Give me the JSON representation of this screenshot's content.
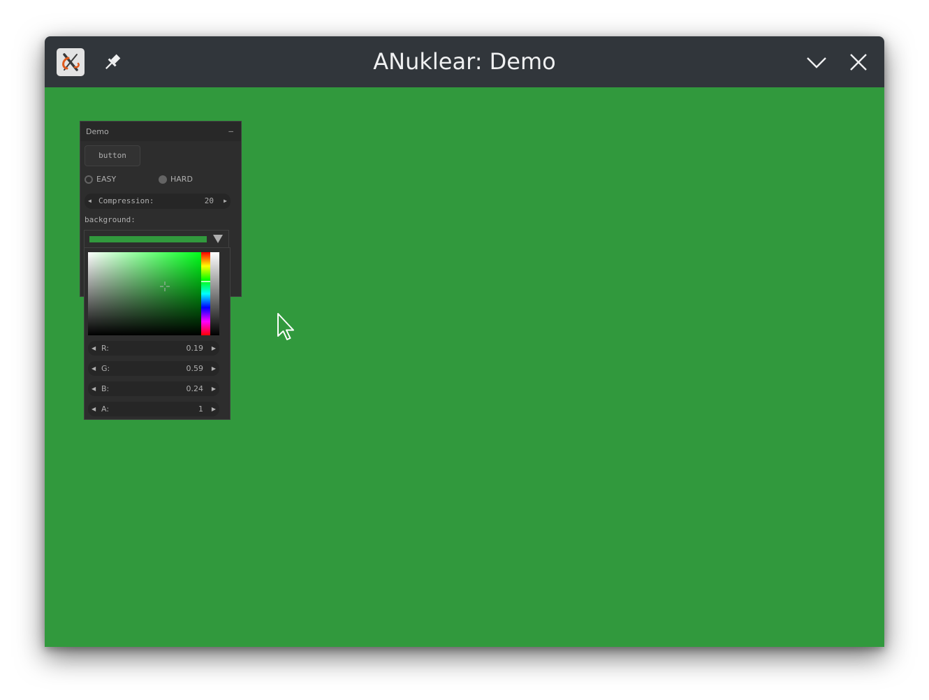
{
  "window": {
    "title": "ANuklear: Demo",
    "background_color": "#31993d",
    "titlebar_color": "#31363b"
  },
  "titlebar": {
    "app_icon": "x11-logo-icon",
    "pin_icon": "pin-icon",
    "minimize_icon": "chevron-down-icon",
    "close_icon": "close-icon"
  },
  "demo_panel": {
    "title": "Demo",
    "minimize_label": "–",
    "button_label": "button",
    "options": [
      {
        "label": "EASY",
        "selected": true
      },
      {
        "label": "HARD",
        "selected": false
      }
    ],
    "compression": {
      "label": "Compression:",
      "value": "20"
    },
    "background_label": "background:"
  },
  "color_picker": {
    "selected_color": "#31993d",
    "hue_color": "#00ff1a",
    "hue_position": 0.35,
    "sv_position": {
      "saturation": 0.68,
      "value": 0.59
    },
    "channels": [
      {
        "label": "R:",
        "value": "0.19"
      },
      {
        "label": "G:",
        "value": "0.59"
      },
      {
        "label": "B:",
        "value": "0.24"
      },
      {
        "label": "A:",
        "value": "1"
      }
    ]
  },
  "cursor": {
    "icon": "mouse-pointer-icon"
  }
}
